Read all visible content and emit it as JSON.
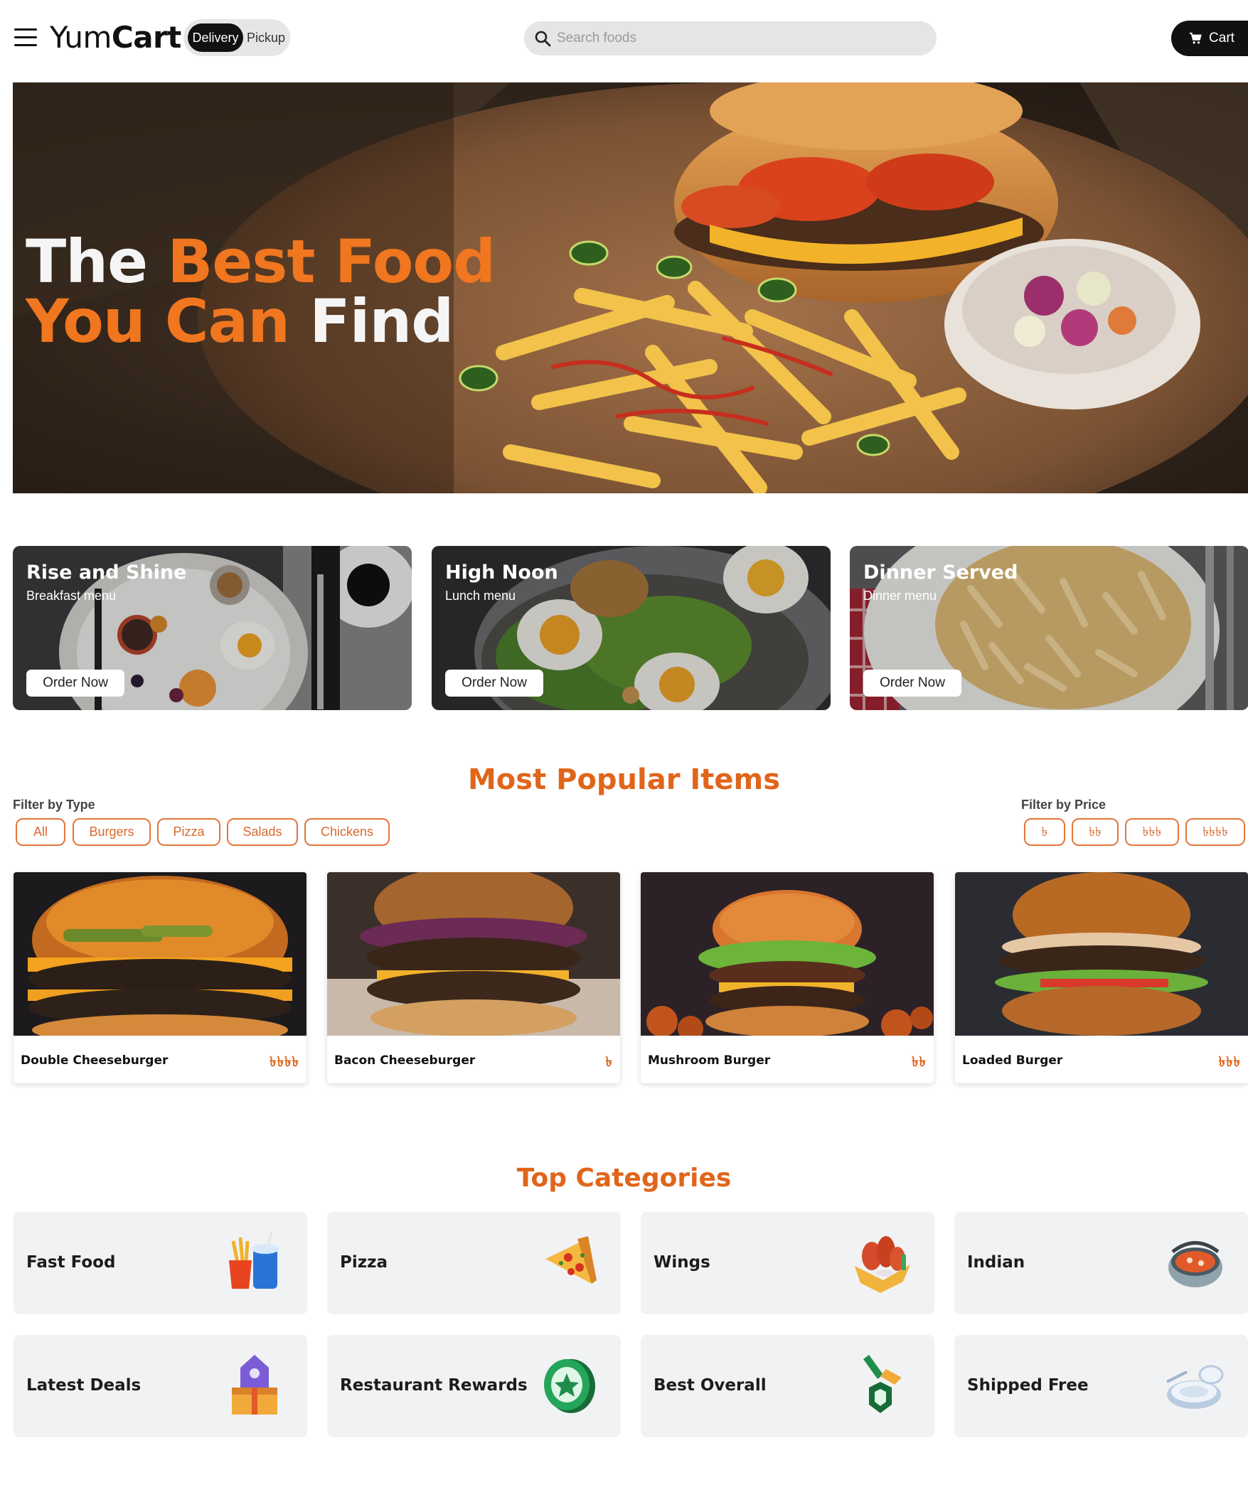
{
  "header": {
    "logo_light": "Yum",
    "logo_bold": "Cart",
    "toggle": {
      "active": "Delivery",
      "inactive": "Pickup"
    },
    "search_placeholder": "Search foods",
    "cart_label": "Cart"
  },
  "hero": {
    "line1_white": "The",
    "line1_orange": "Best Food",
    "line2_orange": "You Can",
    "line2_white": "Find"
  },
  "menus": [
    {
      "title": "Rise and Shine",
      "subtitle": "Breakfast menu",
      "button": "Order Now"
    },
    {
      "title": "High Noon",
      "subtitle": "Lunch menu",
      "button": "Order Now"
    },
    {
      "title": "Dinner Served",
      "subtitle": "Dinner menu",
      "button": "Order Now"
    }
  ],
  "popular": {
    "title": "Most Popular Items",
    "type_label": "Filter by Type",
    "type_filters": [
      "All",
      "Burgers",
      "Pizza",
      "Salads",
      "Chickens"
    ],
    "price_label": "Filter by Price",
    "price_filters": [
      "৳",
      "৳৳",
      "৳৳৳",
      "৳৳৳৳"
    ],
    "items": [
      {
        "name": "Double Cheeseburger",
        "price": "৳৳৳৳"
      },
      {
        "name": "Bacon Cheeseburger",
        "price": "৳"
      },
      {
        "name": "Mushroom Burger",
        "price": "৳৳"
      },
      {
        "name": "Loaded Burger",
        "price": "৳৳৳"
      }
    ]
  },
  "categories": {
    "title": "Top Categories",
    "items": [
      {
        "label": "Fast Food",
        "icon": "fast-food-icon"
      },
      {
        "label": "Pizza",
        "icon": "pizza-icon"
      },
      {
        "label": "Wings",
        "icon": "wings-icon"
      },
      {
        "label": "Indian",
        "icon": "curry-bowl-icon"
      },
      {
        "label": "Latest Deals",
        "icon": "deals-gift-icon"
      },
      {
        "label": "Restaurant Rewards",
        "icon": "reward-coin-icon"
      },
      {
        "label": "Best Overall",
        "icon": "medal-icon"
      },
      {
        "label": "Shipped Free",
        "icon": "plate-icon"
      }
    ]
  },
  "colors": {
    "accent": "#e0651a",
    "hero_orange": "#f0761f",
    "dark": "#111111",
    "card_bg": "#f1f2f4"
  }
}
